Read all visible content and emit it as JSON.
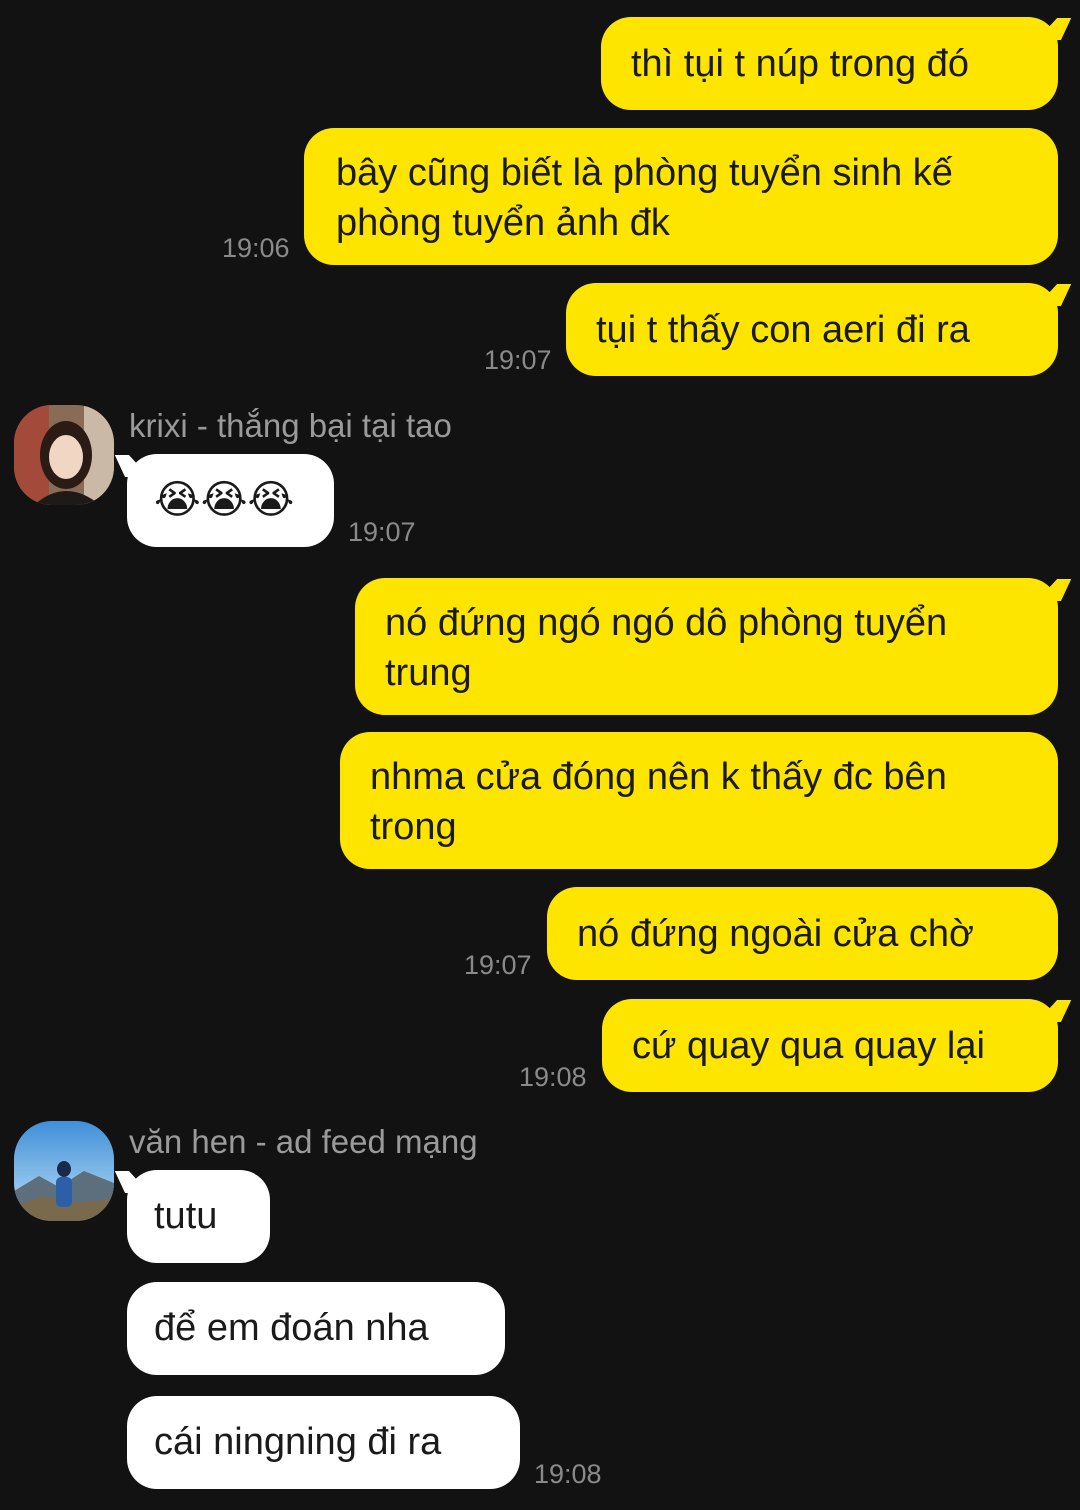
{
  "messages": {
    "m1": "thì tụi t núp trong đó",
    "m2": "bây cũng biết là phòng tuyển sinh kế\nphòng tuyển ảnh đk",
    "m2_time": "19:06",
    "m3": "tụi t thấy con aeri đi ra",
    "m3_time": "19:07",
    "krixi_name": "krixi - thắng bại tại tao",
    "m4": "😭😭😭",
    "m4_time": "19:07",
    "m5": "nó đứng ngó ngó dô phòng tuyển\ntrung",
    "m6": "nhma cửa đóng nên k thấy đc bên\ntrong",
    "m7": "nó đứng ngoài cửa chờ",
    "m7_time": "19:07",
    "m8": "cứ quay qua quay lại",
    "m8_time": "19:08",
    "vanhen_name": "văn hen - ad feed mạng",
    "m9": "tutu",
    "m10": "để em đoán nha",
    "m11": "cái ningning đi ra",
    "m11_time": "19:08"
  },
  "colors": {
    "background": "#121212",
    "my_bubble": "#fee500",
    "their_bubble": "#ffffff",
    "timestamp": "#8a8a8a"
  },
  "icons": {
    "krixi_avatar": "avatar-photo-girl",
    "vanhen_avatar": "avatar-photo-mountain"
  }
}
